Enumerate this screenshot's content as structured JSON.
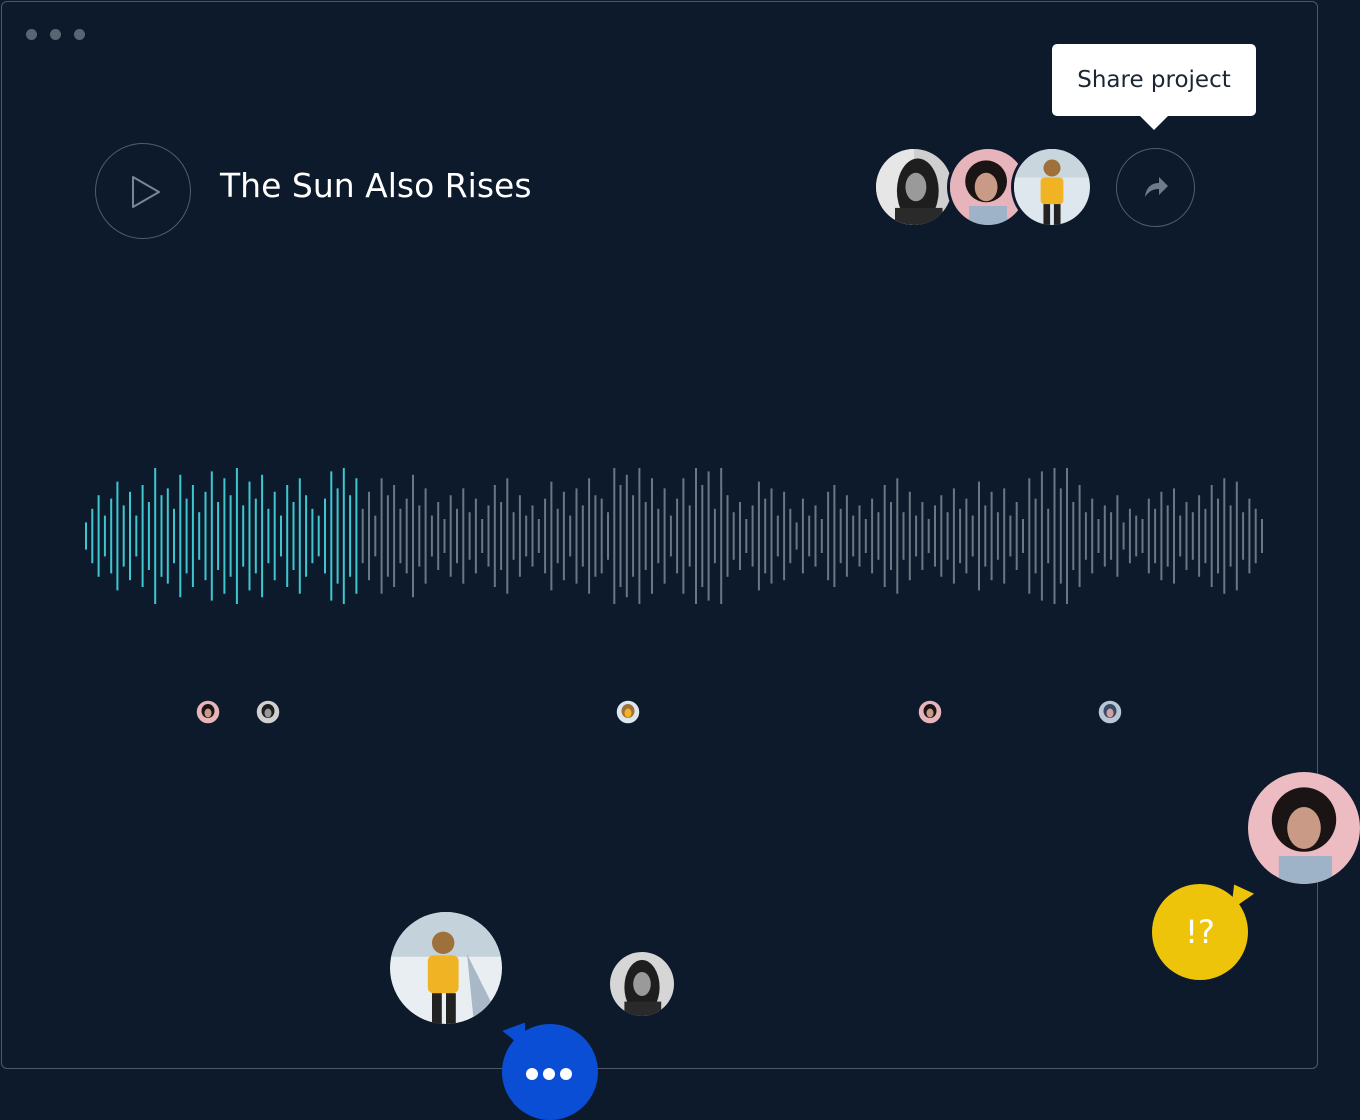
{
  "header": {
    "title": "The Sun Also Rises",
    "play_icon": "play-icon",
    "share_icon": "share-icon"
  },
  "tooltip": {
    "text": "Share project"
  },
  "collaborators": [
    {
      "name": "woman-dark-hair",
      "style": "bw"
    },
    {
      "name": "woman-bob-pink",
      "style": "pink"
    },
    {
      "name": "person-yellow-sweater",
      "style": "yellow"
    }
  ],
  "waveform": {
    "progress": 0.235,
    "played_color": "#3fc7cf",
    "unplayed_color": "#6b7784",
    "amplitudes": [
      0.2,
      0.4,
      0.6,
      0.3,
      0.55,
      0.8,
      0.45,
      0.65,
      0.3,
      0.75,
      0.5,
      1.0,
      0.6,
      0.7,
      0.4,
      0.9,
      0.55,
      0.75,
      0.35,
      0.65,
      0.95,
      0.5,
      0.85,
      0.6,
      1.0,
      0.45,
      0.8,
      0.55,
      0.9,
      0.4,
      0.65,
      0.3,
      0.75,
      0.5,
      0.85,
      0.6,
      0.4,
      0.3,
      0.55,
      0.95,
      0.7,
      1.0,
      0.6,
      0.85,
      0.4,
      0.65,
      0.3,
      0.85,
      0.6,
      0.75,
      0.4,
      0.55,
      0.9,
      0.45,
      0.7,
      0.3,
      0.5,
      0.25,
      0.6,
      0.4,
      0.7,
      0.35,
      0.55,
      0.25,
      0.45,
      0.75,
      0.5,
      0.85,
      0.35,
      0.6,
      0.3,
      0.45,
      0.25,
      0.55,
      0.8,
      0.4,
      0.65,
      0.3,
      0.7,
      0.45,
      0.85,
      0.6,
      0.55,
      0.35,
      1.0,
      0.75,
      0.9,
      0.6,
      1.0,
      0.5,
      0.85,
      0.4,
      0.7,
      0.3,
      0.55,
      0.85,
      0.45,
      1.0,
      0.75,
      0.95,
      0.4,
      1.0,
      0.6,
      0.35,
      0.5,
      0.25,
      0.45,
      0.8,
      0.55,
      0.7,
      0.3,
      0.65,
      0.4,
      0.2,
      0.55,
      0.3,
      0.45,
      0.25,
      0.65,
      0.75,
      0.4,
      0.6,
      0.3,
      0.45,
      0.25,
      0.55,
      0.35,
      0.75,
      0.5,
      0.85,
      0.35,
      0.65,
      0.3,
      0.5,
      0.25,
      0.45,
      0.6,
      0.35,
      0.7,
      0.4,
      0.55,
      0.3,
      0.8,
      0.45,
      0.65,
      0.35,
      0.7,
      0.3,
      0.5,
      0.25,
      0.85,
      0.55,
      0.95,
      0.4,
      1.0,
      0.7,
      1.0,
      0.5,
      0.75,
      0.35,
      0.55,
      0.25,
      0.45,
      0.35,
      0.6,
      0.2,
      0.4,
      0.3,
      0.25,
      0.55,
      0.4,
      0.65,
      0.45,
      0.7,
      0.3,
      0.5,
      0.35,
      0.6,
      0.4,
      0.75,
      0.55,
      0.85,
      0.45,
      0.8,
      0.35,
      0.55,
      0.4,
      0.25
    ],
    "markers": [
      {
        "style": "pink",
        "name": "comment-marker-1"
      },
      {
        "style": "bw",
        "name": "comment-marker-2"
      },
      {
        "style": "yellow",
        "name": "comment-marker-3"
      },
      {
        "style": "pink",
        "name": "comment-marker-4"
      },
      {
        "style": "blue",
        "name": "comment-marker-5"
      }
    ]
  },
  "bubbles": {
    "typing_icon": "typing-dots-icon",
    "reaction_text": "!?"
  },
  "colors": {
    "background": "#0c1a2b",
    "accent_blue": "#0a4ed6",
    "accent_yellow": "#edc40a",
    "waveform_played": "#3fc7cf"
  }
}
